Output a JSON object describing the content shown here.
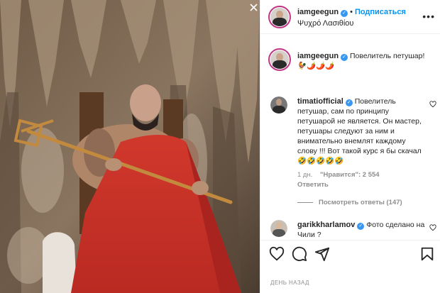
{
  "post": {
    "author": "iamgeegun",
    "follow_label": "Подписаться",
    "location": "Ψυχρό Λασιθίου",
    "caption": "Повелитель петушар! 🐓🌶️🌶️🌶️",
    "time_ago": "ДЕНЬ НАЗАД"
  },
  "comments": [
    {
      "user": "timatiofficial",
      "text": "Повелитель петушар, сам по принципу петушарой не является. Он мастер, петушары следуют за ним и внимательно внемлят каждому слову !!! Вот такой курс я бы скачал 🤣🤣🤣🤣🤣",
      "age": "1 дн.",
      "likes": "\"Нравится\": 2 554",
      "reply_label": "Ответить",
      "view_replies": "Посмотреть ответы (147)"
    },
    {
      "user": "garikkharlamov",
      "text": "Фото сделано на Чили ?"
    }
  ],
  "icons": {
    "more": "more-icon",
    "verified": "verified-icon",
    "like": "heart-icon",
    "comment": "comment-icon",
    "share": "share-icon",
    "save": "bookmark-icon",
    "close": "close-icon"
  },
  "colors": {
    "accent": "#0095f6",
    "verified": "#3897f0",
    "muted": "#8e8e8e",
    "text": "#262626"
  }
}
